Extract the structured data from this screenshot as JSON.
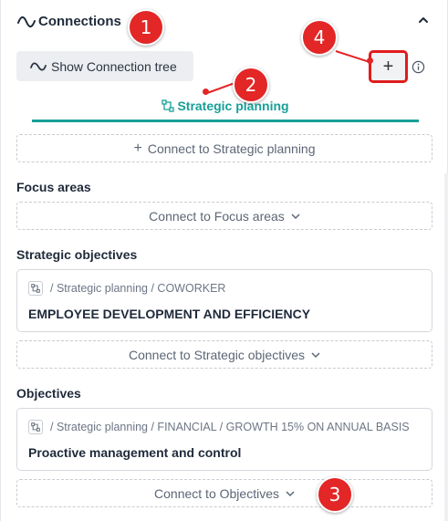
{
  "header": {
    "title": "Connections",
    "icon": "wave-icon",
    "collapse_icon": "chevron-up-icon"
  },
  "toolbar": {
    "tree_button_label": "Show Connection tree",
    "add_label": "+",
    "info_icon": "info-icon"
  },
  "tab": {
    "label": "Strategic planning",
    "icon": "hierarchy-icon",
    "color": "#17a097"
  },
  "connect_top": {
    "label": "Connect to Strategic planning"
  },
  "sections": {
    "focus": {
      "title": "Focus areas",
      "connect_label": "Connect to Focus areas"
    },
    "strategic": {
      "title": "Strategic objectives",
      "card": {
        "path": "/ Strategic planning / COWORKER",
        "name": "EMPLOYEE DEVELOPMENT AND EFFICIENCY"
      },
      "connect_label": "Connect to Strategic objectives"
    },
    "objectives": {
      "title": "Objectives",
      "card": {
        "path": "/ Strategic planning / FINANCIAL / GROWTH 15% ON ANNUAL BASIS",
        "name": "Proactive management and control"
      },
      "connect_label": "Connect to Objectives"
    }
  },
  "annotations": {
    "b1": "1",
    "b2": "2",
    "b3": "3",
    "b4": "4",
    "color": "#e32626"
  }
}
